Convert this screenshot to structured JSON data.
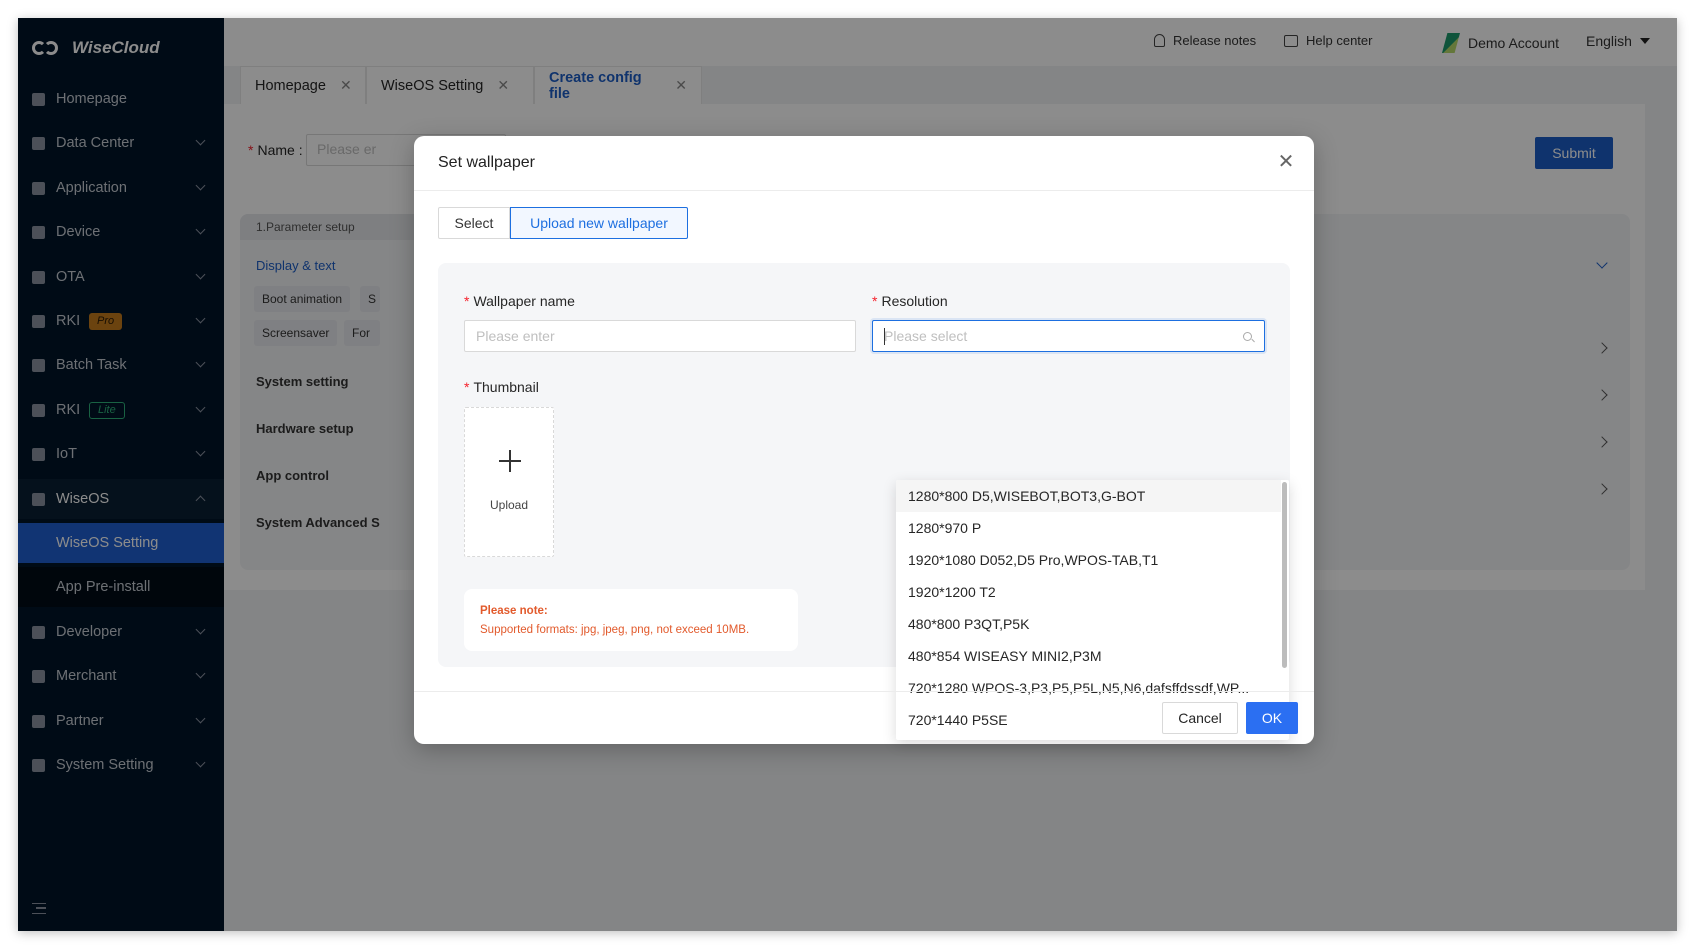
{
  "app": {
    "logo_text": "WiseCloud"
  },
  "sidebar": {
    "items": [
      {
        "label": "Homepage",
        "icon": "home-icon"
      },
      {
        "label": "Data Center",
        "icon": "chart-icon"
      },
      {
        "label": "Application",
        "icon": "grid-icon"
      },
      {
        "label": "Device",
        "icon": "device-icon"
      },
      {
        "label": "OTA",
        "icon": "cube-icon"
      },
      {
        "label": "RKI",
        "icon": "shield-icon",
        "badge": "Pro"
      },
      {
        "label": "Batch Task",
        "icon": "lock-icon"
      },
      {
        "label": "RKI",
        "icon": "key-icon",
        "badge": "Lite"
      },
      {
        "label": "IoT",
        "icon": "iot-icon"
      },
      {
        "label": "WiseOS",
        "icon": "os-icon"
      },
      {
        "label": "Developer",
        "icon": "cloud-icon"
      },
      {
        "label": "Merchant",
        "icon": "merchant-icon"
      },
      {
        "label": "Partner",
        "icon": "partner-icon"
      },
      {
        "label": "System Setting",
        "icon": "gear-icon"
      }
    ],
    "wiseos_sub": [
      "WiseOS Setting",
      "App Pre-install"
    ]
  },
  "header": {
    "release_notes": "Release notes",
    "help_center": "Help center",
    "account": "Demo Account",
    "language": "English"
  },
  "tabs": [
    {
      "label": "Homepage"
    },
    {
      "label": "WiseOS Setting"
    },
    {
      "label": "Create config file"
    }
  ],
  "content": {
    "name_label": "Name :",
    "name_placeholder": "Please er",
    "submit": "Submit",
    "param_title": "1.Parameter setup",
    "display_text": "Display & text",
    "chips": [
      "Boot animation",
      "S",
      "Screensaver",
      "For"
    ],
    "sections": [
      "System setting",
      "Hardware setup",
      "App control",
      "System Advanced S"
    ]
  },
  "modal": {
    "title": "Set wallpaper",
    "seg_select": "Select",
    "seg_upload": "Upload new wallpaper",
    "wallpaper_name_label": "Wallpaper name",
    "wallpaper_name_placeholder": "Please enter",
    "resolution_label": "Resolution",
    "resolution_placeholder": "Please select",
    "thumbnail_label": "Thumbnail",
    "upload_text": "Upload",
    "note_title": "Please note:",
    "note_text": "Supported formats: jpg, jpeg, png, not exceed 10MB.",
    "cancel": "Cancel",
    "ok": "OK",
    "resolution_options": [
      "1280*800 D5,WISEBOT,BOT3,G-BOT",
      "1280*970 P",
      "1920*1080 D052,D5 Pro,WPOS-TAB,T1",
      "1920*1200 T2",
      "480*800 P3QT,P5K",
      "480*854 WISEASY MINI2,P3M",
      "720*1280 WPOS-3,P3,P5,P5L,N5,N6,dafsffdssdf,WP...",
      "720*1440 P5SE"
    ]
  },
  "colors": {
    "sidebar_bg": "#001529",
    "primary": "#2b6ff2",
    "active_nav": "#1f5fd1",
    "note_text": "#e25a2c"
  }
}
